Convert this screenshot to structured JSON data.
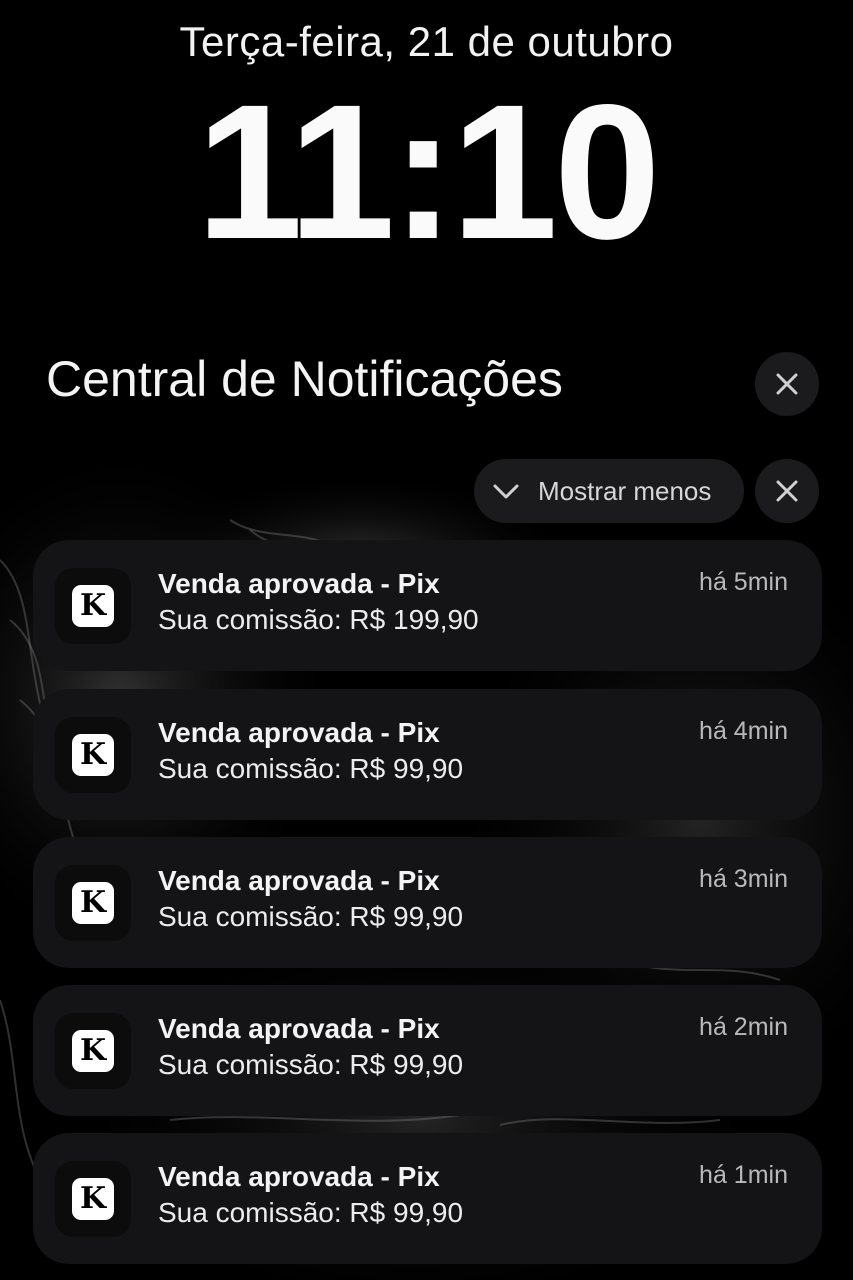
{
  "lockscreen": {
    "date": "Terça-feira, 21 de outubro",
    "time": "11:10"
  },
  "notification_center": {
    "title": "Central de Notificações",
    "close_icon": "close-icon"
  },
  "group_controls": {
    "show_less_label": "Mostrar menos",
    "show_less_icon": "chevron-down-icon",
    "close_icon": "close-icon"
  },
  "notifications": [
    {
      "app_icon_letter": "K",
      "title": "Venda aprovada - Pix",
      "body": "Sua comissão: R$ 199,90",
      "time": "há 5min"
    },
    {
      "app_icon_letter": "K",
      "title": "Venda aprovada - Pix",
      "body": "Sua comissão: R$ 99,90",
      "time": "há 4min"
    },
    {
      "app_icon_letter": "K",
      "title": "Venda aprovada - Pix",
      "body": "Sua comissão: R$ 99,90",
      "time": "há 3min"
    },
    {
      "app_icon_letter": "K",
      "title": "Venda aprovada - Pix",
      "body": "Sua comissão: R$ 99,90",
      "time": "há 2min"
    },
    {
      "app_icon_letter": "K",
      "title": "Venda aprovada - Pix",
      "body": "Sua comissão: R$ 99,90",
      "time": "há 1min"
    }
  ],
  "colors": {
    "background": "#000000",
    "card": "#141416",
    "button": "#1b1b1d",
    "text_primary": "#f3f3f3",
    "text_secondary": "#b9b9bc"
  }
}
